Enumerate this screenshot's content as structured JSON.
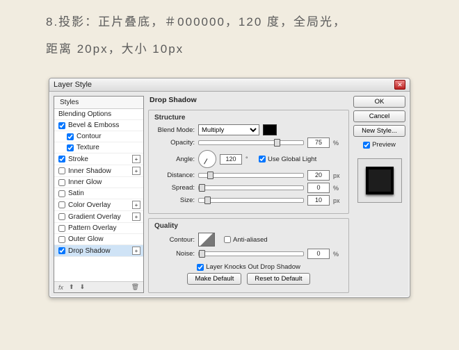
{
  "caption": {
    "line1": "8.投影：正片叠底，＃000000，120 度，全局光，",
    "line2": "距离 20px，大小 10px"
  },
  "dialog": {
    "title": "Layer Style",
    "close_glyph": "✕",
    "styles_header": "Styles",
    "items": [
      {
        "label": "Blending Options",
        "checked": null,
        "indent": false,
        "fx": false,
        "selected": false
      },
      {
        "label": "Bevel & Emboss",
        "checked": true,
        "indent": false,
        "fx": false,
        "selected": false
      },
      {
        "label": "Contour",
        "checked": true,
        "indent": true,
        "fx": false,
        "selected": false
      },
      {
        "label": "Texture",
        "checked": true,
        "indent": true,
        "fx": false,
        "selected": false
      },
      {
        "label": "Stroke",
        "checked": true,
        "indent": false,
        "fx": true,
        "selected": false
      },
      {
        "label": "Inner Shadow",
        "checked": false,
        "indent": false,
        "fx": true,
        "selected": false
      },
      {
        "label": "Inner Glow",
        "checked": false,
        "indent": false,
        "fx": false,
        "selected": false
      },
      {
        "label": "Satin",
        "checked": false,
        "indent": false,
        "fx": false,
        "selected": false
      },
      {
        "label": "Color Overlay",
        "checked": false,
        "indent": false,
        "fx": true,
        "selected": false
      },
      {
        "label": "Gradient Overlay",
        "checked": false,
        "indent": false,
        "fx": true,
        "selected": false
      },
      {
        "label": "Pattern Overlay",
        "checked": false,
        "indent": false,
        "fx": false,
        "selected": false
      },
      {
        "label": "Outer Glow",
        "checked": false,
        "indent": false,
        "fx": false,
        "selected": false
      },
      {
        "label": "Drop Shadow",
        "checked": true,
        "indent": false,
        "fx": true,
        "selected": true
      }
    ],
    "footer_fx": "fx",
    "section_title": "Drop Shadow",
    "structure_legend": "Structure",
    "blend_mode_label": "Blend Mode:",
    "blend_mode_value": "Multiply",
    "opacity_label": "Opacity:",
    "opacity_value": "75",
    "angle_label": "Angle:",
    "angle_value": "120",
    "degree": "°",
    "global_light": "Use Global Light",
    "distance_label": "Distance:",
    "distance_value": "20",
    "px": "px",
    "spread_label": "Spread:",
    "spread_value": "0",
    "size_label": "Size:",
    "size_value": "10",
    "percent": "%",
    "quality_legend": "Quality",
    "contour_label": "Contour:",
    "antialiased": "Anti-aliased",
    "noise_label": "Noise:",
    "noise_value": "0",
    "knockout": "Layer Knocks Out Drop Shadow",
    "make_default": "Make Default",
    "reset_default": "Reset to Default",
    "ok": "OK",
    "cancel": "Cancel",
    "new_style": "New Style...",
    "preview": "Preview"
  }
}
